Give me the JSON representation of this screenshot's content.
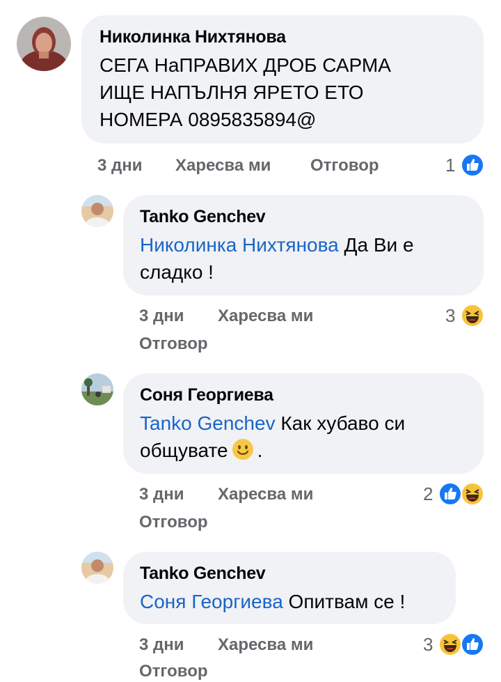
{
  "comments": [
    {
      "author": "Николинка Нихтянова",
      "text_lines": [
        "СЕГА НаПРАВИХ ДРОБ САРМА",
        "ИЩЕ НАПЪЛНЯ ЯРЕТО ЕТО",
        "НОМЕРА 0895835894@"
      ],
      "time": "3 дни",
      "like": "Харесва ми",
      "reply": "Отговор",
      "reaction_count": "1",
      "reactions": [
        "like-icon"
      ]
    },
    {
      "author": "Tanko Genchev",
      "mention": "Николинка Нихтянова",
      "text_rest": "Да Ви е",
      "text_line2": "сладко !",
      "time": "3 дни",
      "like": "Харесва ми",
      "reply": "Отговор",
      "reaction_count": "3",
      "reactions": [
        "haha-icon"
      ]
    },
    {
      "author": "Соня Георгиева",
      "mention": "Tanko Genchev",
      "text_rest": "Как хубаво си",
      "text_line2": "общувате",
      "text_end": ".",
      "emoji": "smile-emoji",
      "time": "3 дни",
      "like": "Харесва ми",
      "reply": "Отговор",
      "reaction_count": "2",
      "reactions": [
        "like-icon",
        "haha-icon"
      ]
    },
    {
      "author": "Tanko Genchev",
      "mention": "Соня Георгиева",
      "text_rest": "Опитвам се !",
      "time": "3 дни",
      "like": "Харесва ми",
      "reply": "Отговор",
      "reaction_count": "3",
      "reactions": [
        "haha-icon",
        "like-icon"
      ]
    }
  ],
  "colors": {
    "bubble": "#f0f2f5",
    "mention": "#1a64c8",
    "meta": "#65676b",
    "like_blue": "#1877f2",
    "haha_yellow": "#f7c33a"
  }
}
